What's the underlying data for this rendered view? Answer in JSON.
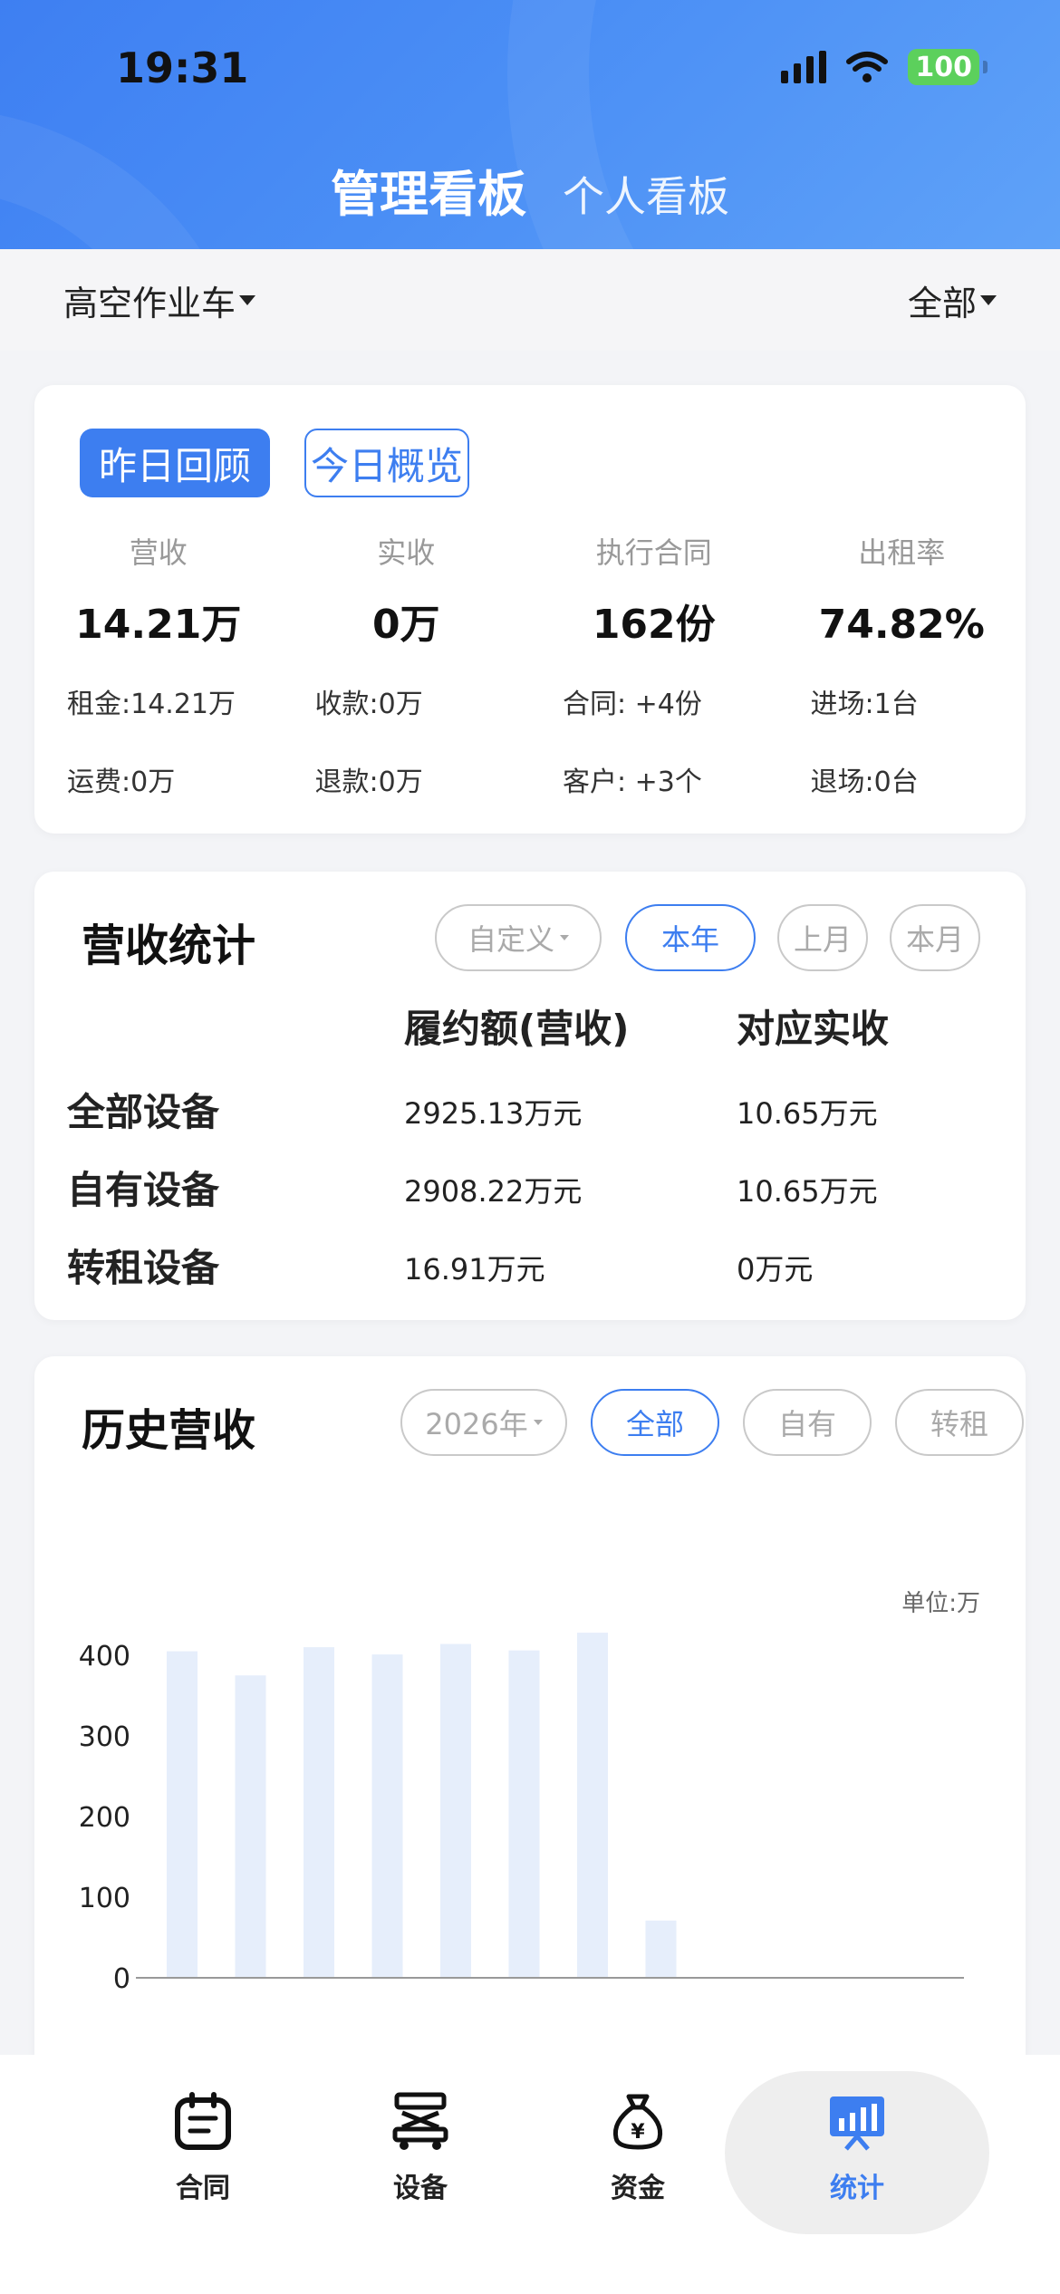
{
  "status": {
    "time": "19:31",
    "battery": "100"
  },
  "header": {
    "tab_main": "管理看板",
    "tab_sub": "个人看板"
  },
  "filters": {
    "category": "高空作业车",
    "scope": "全部"
  },
  "overview": {
    "seg_active": "昨日回顾",
    "seg_idle": "今日概览",
    "kpis": [
      {
        "label": "营收",
        "value": "14.21万",
        "sub1": "租金:14.21万",
        "sub2": "运费:0万"
      },
      {
        "label": "实收",
        "value": "0万",
        "sub1": "收款:0万",
        "sub2": "退款:0万"
      },
      {
        "label": "执行合同",
        "value": "162份",
        "sub1": "合同: +4份",
        "sub2": "客户: +3个"
      },
      {
        "label": "出租率",
        "value": "74.82%",
        "sub1": "进场:1台",
        "sub2": "退场:0台"
      }
    ]
  },
  "revenue_stats": {
    "title": "营收统计",
    "filters": [
      "自定义",
      "本年",
      "上月",
      "本月"
    ],
    "col1": "履约额(营收)",
    "col2": "对应实收",
    "rows": [
      {
        "name": "全部设备",
        "v1": "2925.13万元",
        "v2": "10.65万元"
      },
      {
        "name": "自有设备",
        "v1": "2908.22万元",
        "v2": "10.65万元"
      },
      {
        "name": "转租设备",
        "v1": "16.91万元",
        "v2": "0万元"
      }
    ]
  },
  "history": {
    "title": "历史营收",
    "year": "2026年",
    "filters": [
      "全部",
      "自有",
      "转租"
    ],
    "unit": "单位:万"
  },
  "chart_data": {
    "type": "bar",
    "title": "",
    "xlabel": "",
    "ylabel": "",
    "ylim": [
      0,
      400
    ],
    "yticks": [
      0,
      100,
      200,
      300,
      400
    ],
    "values": [
      405,
      375,
      410,
      401,
      414,
      406,
      428,
      71
    ],
    "bar_color": "#e6eefb"
  },
  "nav": {
    "items": [
      {
        "label": "合同",
        "icon": "contract-icon"
      },
      {
        "label": "设备",
        "icon": "equipment-icon"
      },
      {
        "label": "资金",
        "icon": "money-bag-icon"
      },
      {
        "label": "统计",
        "icon": "stats-icon"
      }
    ],
    "active_color": "#3d7ef0"
  }
}
